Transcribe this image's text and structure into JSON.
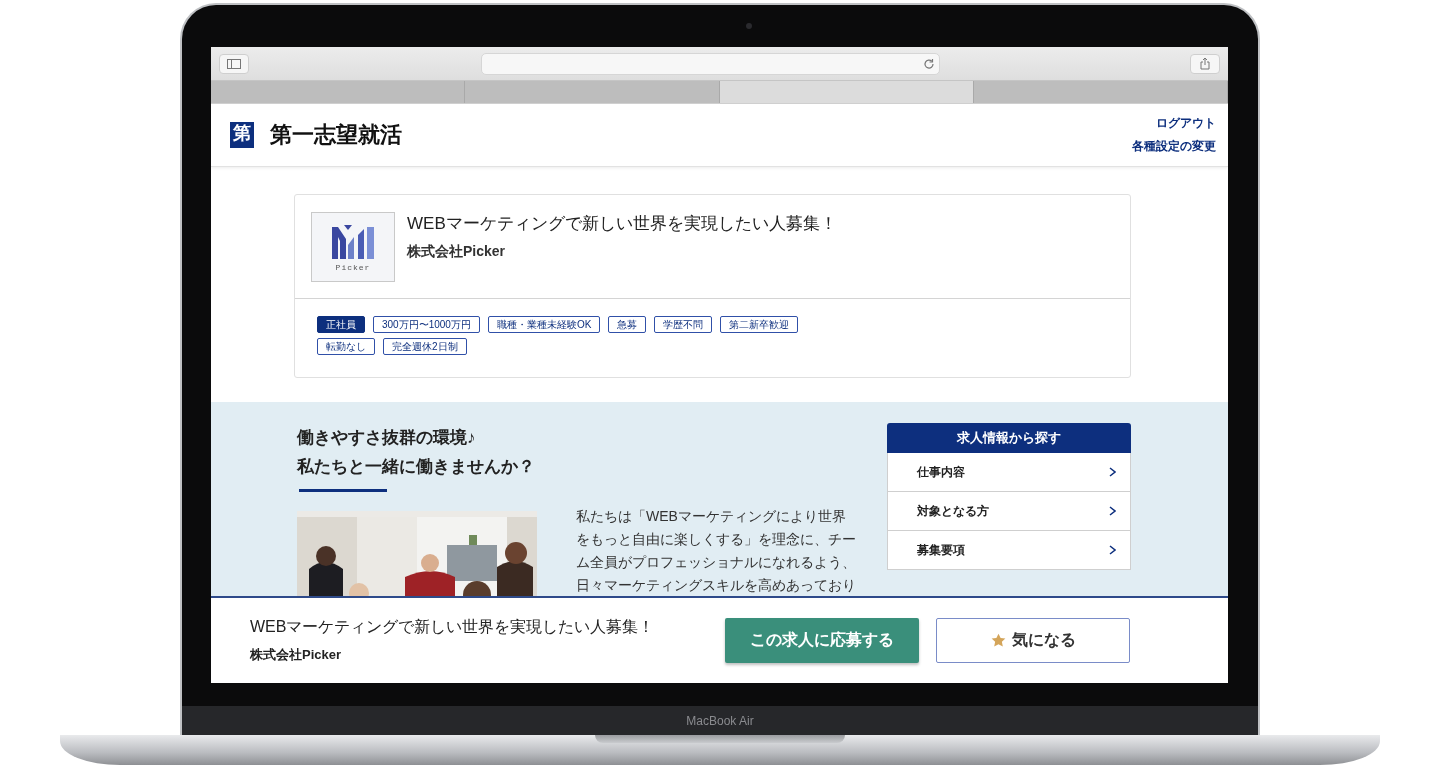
{
  "device": {
    "label": "MacBook Air"
  },
  "browser": {
    "tabs": [
      {
        "selected": false
      },
      {
        "selected": false
      },
      {
        "selected": true
      },
      {
        "selected": false
      }
    ]
  },
  "header": {
    "logo_char": "第",
    "site_name": "第一志望就活",
    "links": [
      "ログアウト",
      "各種設定の変更"
    ]
  },
  "job": {
    "logo_text": "Picker",
    "title": "WEBマーケティングで新しい世界を実現したい人募集！",
    "company": "株式会社Picker",
    "tags": [
      {
        "label": "正社員",
        "kind": "filled"
      },
      {
        "label": "300万円〜1000万円",
        "kind": "outline"
      },
      {
        "label": "職種・業種未経験OK",
        "kind": "outline"
      },
      {
        "label": "急募",
        "kind": "outline"
      },
      {
        "label": "学歴不問",
        "kind": "outline"
      },
      {
        "label": "第二新卒歓迎",
        "kind": "outline"
      },
      {
        "label": "転勤なし",
        "kind": "outline"
      },
      {
        "label": "完全週休2日制",
        "kind": "outline"
      }
    ]
  },
  "feature": {
    "heading_lines": [
      "働きやすさ抜群の環境♪",
      "私たちと一緒に働きませんか？"
    ],
    "photo": {
      "kind": "picture"
    },
    "paragraph_lines": [
      "私たちは「WEBマーケティングにより世界",
      "をもっと自由に楽しくする」を理念に、チー",
      "ム全員がプロフェッショナルになれるよう、",
      "日々マーケティングスキルを高めあっており"
    ]
  },
  "side_menu": {
    "title": "求人情報から探す",
    "items": [
      "仕事内容",
      "対象となる方",
      "募集要項"
    ]
  },
  "sticky_bar": {
    "title": "WEBマーケティングで新しい世界を実現したい人募集！",
    "company": "株式会社Picker",
    "apply_button": "この求人に応募する",
    "favorite_button": "気になる"
  }
}
